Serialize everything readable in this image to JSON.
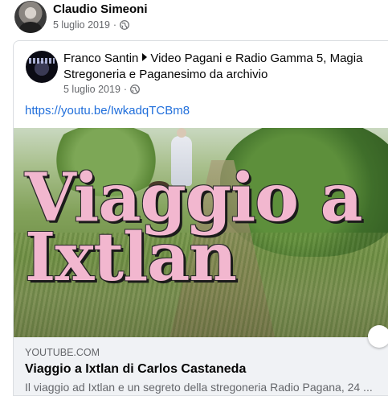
{
  "post": {
    "author": "Claudio Simeoni",
    "date": "5 luglio 2019",
    "privacy_icon": "globe-icon"
  },
  "shared": {
    "author": "Franco Santin",
    "target": "Video Pagani e Radio Gamma 5, Magia Stregoneria e Paganesimo da archivio",
    "date": "5 luglio 2019",
    "privacy_icon": "globe-icon",
    "link": "https://youtu.be/IwkadqTCBm8"
  },
  "preview": {
    "overlay_line1": "Viaggio a",
    "overlay_line2": "Ixtlan",
    "domain": "YOUTUBE.COM",
    "title": "Viaggio a Ixtlan di Carlos Castaneda",
    "description": "Il viaggio ad Ixtlan e un segreto della stregoneria Radio Pagana, 24 ..."
  },
  "colors": {
    "link": "#216fdb",
    "meta": "#65676b",
    "caption_bg": "#f0f2f5",
    "overlay_text": "#f2b7cf"
  }
}
